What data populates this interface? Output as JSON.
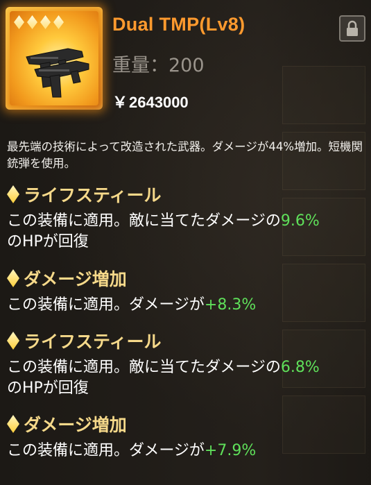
{
  "item": {
    "name": "Dual TMP(Lv8)",
    "weight_label": "重量：200",
    "price_symbol": "￥",
    "price": "2643000",
    "stars": 4,
    "icon": "submachine-gun-icon",
    "lock_icon": "lock-icon"
  },
  "description": "最先端の技術によって改造された武器。ダメージが44%増加。短機関銃弾を使用。",
  "effects": [
    {
      "title": "ライフスティール",
      "text_prefix": "この装備に適用。敵に当てたダメージの",
      "value": "9.6%",
      "text_suffix": "のHPが回復"
    },
    {
      "title": "ダメージ増加",
      "text_prefix": "この装備に適用。ダメージが",
      "value": "+8.3%",
      "text_suffix": ""
    },
    {
      "title": "ライフスティール",
      "text_prefix": "この装備に適用。敵に当てたダメージの",
      "value": "6.8%",
      "text_suffix": "のHPが回復"
    },
    {
      "title": "ダメージ増加",
      "text_prefix": "この装備に適用。ダメージが",
      "value": "+7.9%",
      "text_suffix": ""
    }
  ],
  "colors": {
    "title": "#ff9a2e",
    "effect_title": "#f6d98a",
    "value_green": "#5fe05a",
    "frame_gold": "#f7b737"
  }
}
